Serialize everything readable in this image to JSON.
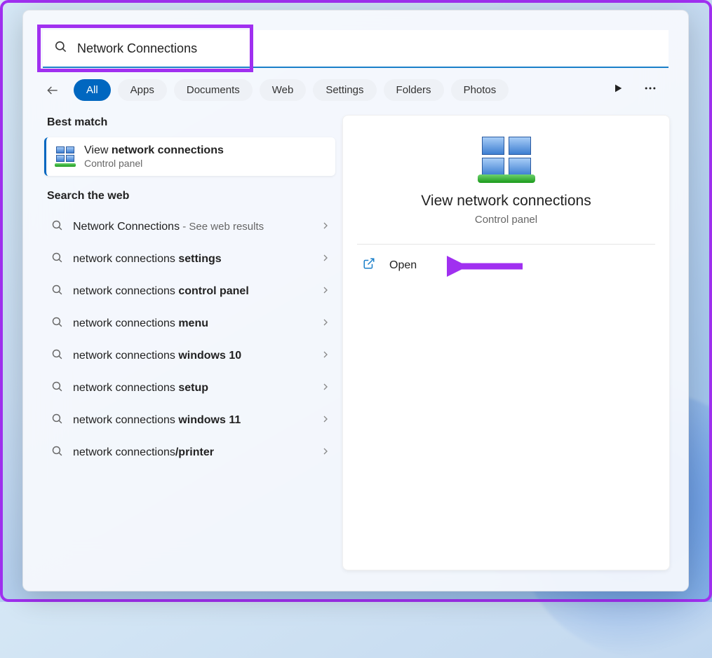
{
  "search": {
    "value": "Network Connections"
  },
  "filters": {
    "items": [
      "All",
      "Apps",
      "Documents",
      "Web",
      "Settings",
      "Folders",
      "Photos"
    ],
    "active_index": 0
  },
  "sections": {
    "best_match_heading": "Best match",
    "search_web_heading": "Search the web"
  },
  "best_match": {
    "title_prefix": "View ",
    "title_bold": "network connections",
    "subtitle": "Control panel"
  },
  "web_suggestions": [
    {
      "prefix": "Network Connections",
      "bold": "",
      "suffix": " - See web results"
    },
    {
      "prefix": "network connections ",
      "bold": "settings",
      "suffix": ""
    },
    {
      "prefix": "network connections ",
      "bold": "control panel",
      "suffix": ""
    },
    {
      "prefix": "network connections ",
      "bold": "menu",
      "suffix": ""
    },
    {
      "prefix": "network connections ",
      "bold": "windows 10",
      "suffix": ""
    },
    {
      "prefix": "network connections ",
      "bold": "setup",
      "suffix": ""
    },
    {
      "prefix": "network connections ",
      "bold": "windows 11",
      "suffix": ""
    },
    {
      "prefix": "network connections",
      "bold": "/printer",
      "suffix": ""
    }
  ],
  "preview": {
    "title": "View network connections",
    "subtitle": "Control panel",
    "open_label": "Open"
  },
  "colors": {
    "accent": "#0067c0",
    "annotation": "#a030f0"
  }
}
